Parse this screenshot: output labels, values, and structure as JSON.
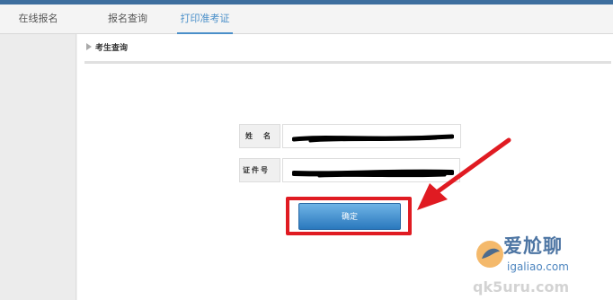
{
  "tabs": [
    {
      "label": "在线报名",
      "active": false
    },
    {
      "label": "报名查询",
      "active": false
    },
    {
      "label": "打印准考证",
      "active": true
    }
  ],
  "section": {
    "title": "考生查询"
  },
  "form": {
    "name_label": "姓　名",
    "id_label": "证件号",
    "name_value": "",
    "id_value": "",
    "confirm_label": "确定"
  },
  "watermark": {
    "brand": "爱尬聊",
    "url": "igaliao.com",
    "url2": "qk5uru.com"
  },
  "colors": {
    "accent": "#4a8fc9",
    "highlight": "#e01b22",
    "button": "#2a78bd"
  }
}
